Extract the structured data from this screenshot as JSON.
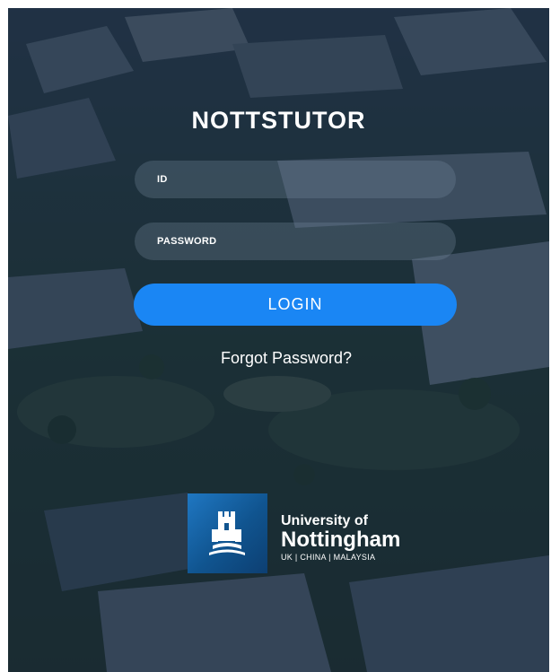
{
  "app": {
    "title": "NOTTSTUTOR"
  },
  "form": {
    "id_placeholder": "ID",
    "password_placeholder": "PASSWORD",
    "login_label": "LOGIN",
    "forgot_label": "Forgot Password?"
  },
  "logo": {
    "line1": "University of",
    "line2": "Nottingham",
    "line3": "UK | CHINA | MALAYSIA"
  },
  "colors": {
    "login_button": "#1a86f4",
    "overlay": "#0e1e30",
    "crest_blue": "#10548f"
  }
}
